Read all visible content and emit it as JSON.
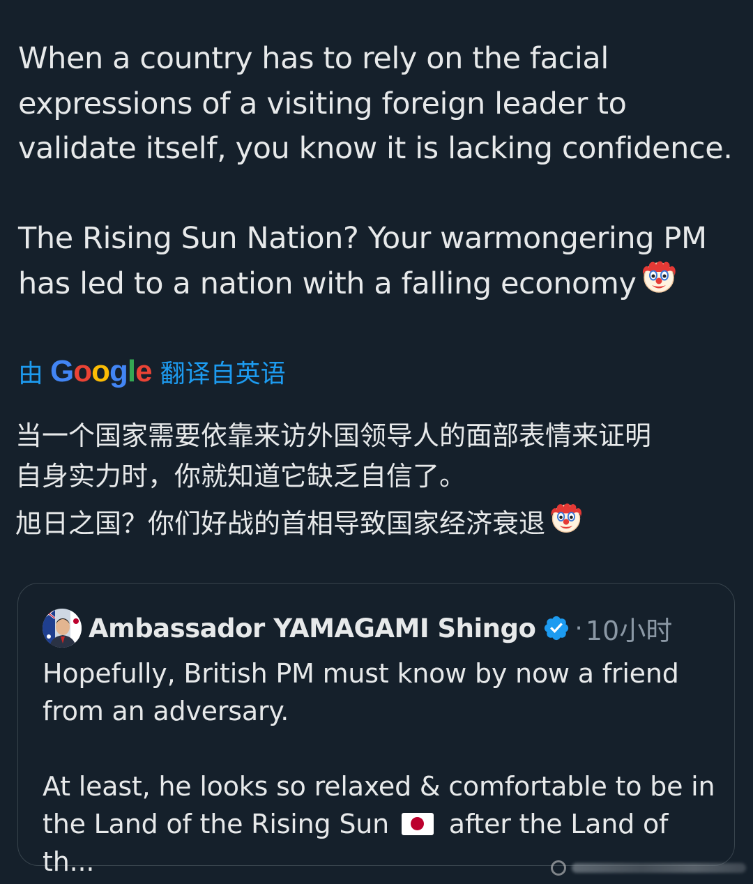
{
  "post": {
    "text": "When a country has to rely on the facial\nexpressions of a visiting foreign leader to\nvalidate itself, you know it is lacking confidence.\n\nThe Rising Sun Nation? Your warmongering PM\nhas led to a nation with a falling economy",
    "emoji": "clown-face"
  },
  "translation": {
    "prefix": "由",
    "provider": "Google",
    "suffix": "翻译自英语",
    "paragraph_1": "当一个国家需要依靠来访外国领导人的面部表情来证明\n自身实力时，你就知道它缺乏自信了。",
    "paragraph_2": "旭日之国？你们好战的首相导致国家经济衰退",
    "emoji": "clown-face"
  },
  "quote": {
    "author": "Ambassador YAMAGAMI Shingo",
    "verified": true,
    "separator": "·",
    "time": "10小时",
    "text_1": "Hopefully, British PM must know by now a friend\nfrom an adversary.",
    "text_2_part_1": "At least, he looks so relaxed  & comfortable to be in\nthe Land of the Rising Sun ",
    "text_2_part_2": " after the Land of th...",
    "flag": "japan-flag"
  },
  "colors": {
    "background": "#15202b",
    "text": "#e7e9ea",
    "link": "#1d9bf0",
    "muted": "#8b98a5",
    "border": "#38444d",
    "verified": "#1d9bf0"
  }
}
